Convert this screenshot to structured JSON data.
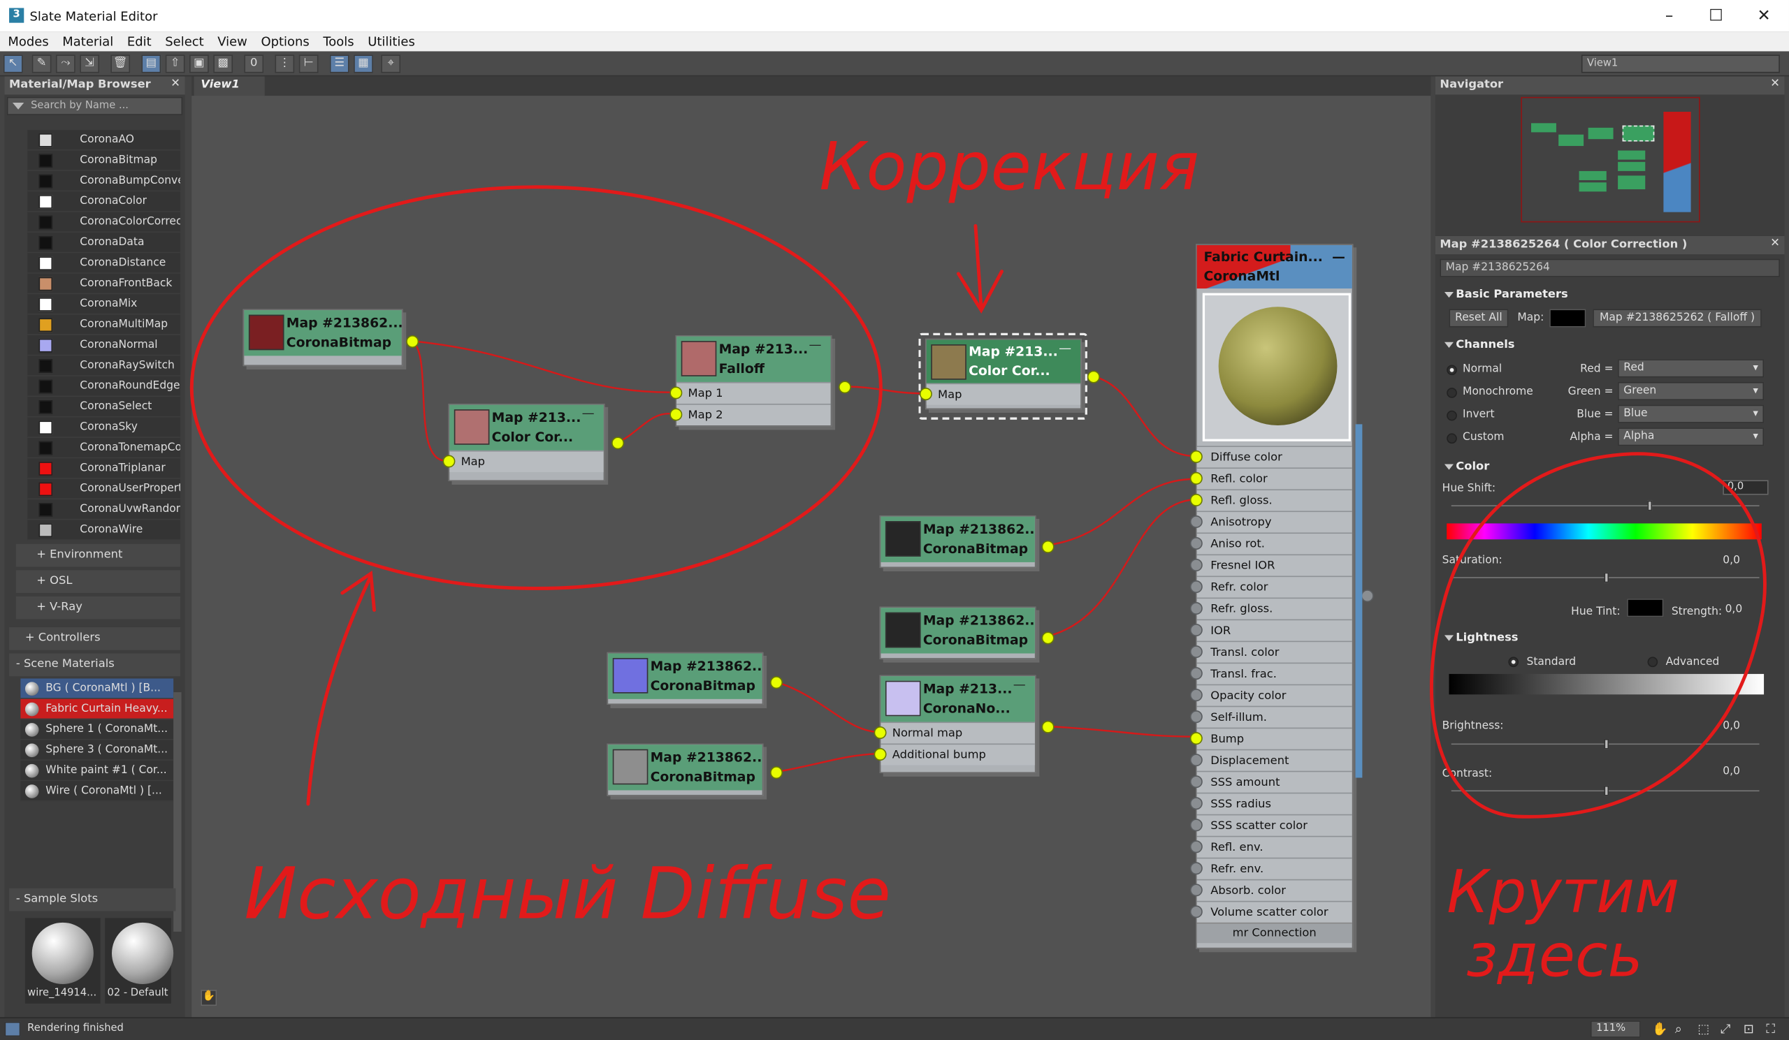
{
  "window": {
    "title": "Slate Material Editor",
    "app_icon": "3"
  },
  "menu": [
    "Modes",
    "Material",
    "Edit",
    "Select",
    "View",
    "Options",
    "Tools",
    "Utilities"
  ],
  "toolbar": {
    "view_selector": "View1"
  },
  "browser": {
    "title": "Material/Map Browser",
    "search_placeholder": "Search by Name ...",
    "maps": [
      {
        "label": "CoronaAO",
        "color": "#dddddd"
      },
      {
        "label": "CoronaBitmap",
        "color": "#111111"
      },
      {
        "label": "CoronaBumpConver...",
        "color": "#111111"
      },
      {
        "label": "CoronaColor",
        "color": "#ffffff"
      },
      {
        "label": "CoronaColorCorrect",
        "color": "#111111"
      },
      {
        "label": "CoronaData",
        "color": "#111111"
      },
      {
        "label": "CoronaDistance",
        "color": "#ffffff"
      },
      {
        "label": "CoronaFrontBack",
        "color": "#c98f6a"
      },
      {
        "label": "CoronaMix",
        "color": "#ffffff"
      },
      {
        "label": "CoronaMultiMap",
        "color": "#e0a020"
      },
      {
        "label": "CoronaNormal",
        "color": "#a8a8f0"
      },
      {
        "label": "CoronaRaySwitch",
        "color": "#111111"
      },
      {
        "label": "CoronaRoundEdges",
        "color": "#111111"
      },
      {
        "label": "CoronaSelect",
        "color": "#111111"
      },
      {
        "label": "CoronaSky",
        "color": "#ffffff"
      },
      {
        "label": "CoronaTonemapCon...",
        "color": "#111111"
      },
      {
        "label": "CoronaTriplanar",
        "color": "#ee1111"
      },
      {
        "label": "CoronaUserProperty",
        "color": "#ee1111"
      },
      {
        "label": "CoronaUvwRandomi...",
        "color": "#111111"
      },
      {
        "label": "CoronaWire",
        "color": "#bbbbbb"
      }
    ],
    "groups": [
      "+ Environment",
      "+ OSL",
      "+ V-Ray"
    ],
    "controllers": "+ Controllers",
    "scene_materials": "- Scene Materials",
    "scene": [
      "BG  ( CoronaMtl )  [B...",
      "Fabric Curtain Heavy...",
      "Sphere 1  ( CoronaMt...",
      "Sphere 3  ( CoronaMt...",
      "White paint #1  ( Cor...",
      "Wire  ( CoronaMtl )  [..."
    ],
    "sample_slots": "- Sample Slots",
    "slot_labels": [
      "wire_14914...",
      "02 - Default"
    ]
  },
  "view": {
    "tab": "View1"
  },
  "nodes": {
    "n1": {
      "title": "Map  #213862...",
      "sub": "CoronaBitmap",
      "thumb": "#7a1f22"
    },
    "n2": {
      "title": "Map  #213...",
      "sub": "Color  Cor...",
      "thumb": "#b07070",
      "slot": "Map"
    },
    "n3": {
      "title": "Map  #213...",
      "sub": "Falloff",
      "thumb": "#b06a6a",
      "slots": [
        "Map 1",
        "Map 2"
      ]
    },
    "n4": {
      "title": "Map  #213...",
      "sub": "Color  Cor...",
      "thumb": "#8d7a4e",
      "slot": "Map"
    },
    "n5": {
      "title": "Map  #213862...",
      "sub": "CoronaBitmap",
      "thumb": "#262626"
    },
    "n6": {
      "title": "Map  #213862...",
      "sub": "CoronaBitmap",
      "thumb": "#262626"
    },
    "n7": {
      "title": "Map  #213862...",
      "sub": "CoronaBitmap",
      "thumb": "#7070e0"
    },
    "n8": {
      "title": "Map  #213862...",
      "sub": "CoronaBitmap",
      "thumb": "#8e8e8e"
    },
    "n9": {
      "title": "Map  #213...",
      "sub": "CoronaNo...",
      "thumb": "#c8c0f0",
      "slots": [
        "Normal map",
        "Additional bump"
      ]
    }
  },
  "curtain": {
    "title": "Fabric Curtain...",
    "sub": "CoronaMtl",
    "slots": [
      "Diffuse color",
      "Refl. color",
      "Refl. gloss.",
      "Anisotropy",
      "Aniso rot.",
      "Fresnel IOR",
      "Refr. color",
      "Refr. gloss.",
      "IOR",
      "Transl. color",
      "Transl. frac.",
      "Opacity color",
      "Self-illum.",
      "Bump",
      "Displacement",
      "SSS amount",
      "SSS radius",
      "SSS scatter color",
      "Refl. env.",
      "Refr. env.",
      "Absorb. color",
      "Volume scatter color"
    ],
    "footer": "mr Connection"
  },
  "navigator": {
    "title": "Navigator"
  },
  "params": {
    "header": "Map #2138625264  ( Color Correction )",
    "name": "Map #2138625264",
    "basic": "Basic Parameters",
    "reset": "Reset All",
    "map_label": "Map:",
    "map_value": "Map #2138625262  ( Falloff )",
    "channels": "Channels",
    "ch_modes": [
      "Normal",
      "Monochrome",
      "Invert",
      "Custom"
    ],
    "ch_labels": [
      "Red =",
      "Green =",
      "Blue =",
      "Alpha ="
    ],
    "ch_values": [
      "Red",
      "Green",
      "Blue",
      "Alpha"
    ],
    "color": "Color",
    "hue_shift": "Hue Shift:",
    "hue_val": "0,0",
    "saturation": "Saturation:",
    "sat_val": "0,0",
    "hue_tint": "Hue Tint:",
    "strength": "Strength:",
    "strength_val": "0,0",
    "lightness": "Lightness",
    "standard": "Standard",
    "advanced": "Advanced",
    "brightness": "Brightness:",
    "bright_val": "0,0",
    "contrast": "Contrast:",
    "contrast_val": "0,0"
  },
  "annotations": {
    "top": "Коррекция",
    "bottom": "Исходный Diffuse",
    "right1": "Крутим",
    "right2": "здесь"
  },
  "status": {
    "text": "Rendering finished",
    "zoom": "111%"
  }
}
